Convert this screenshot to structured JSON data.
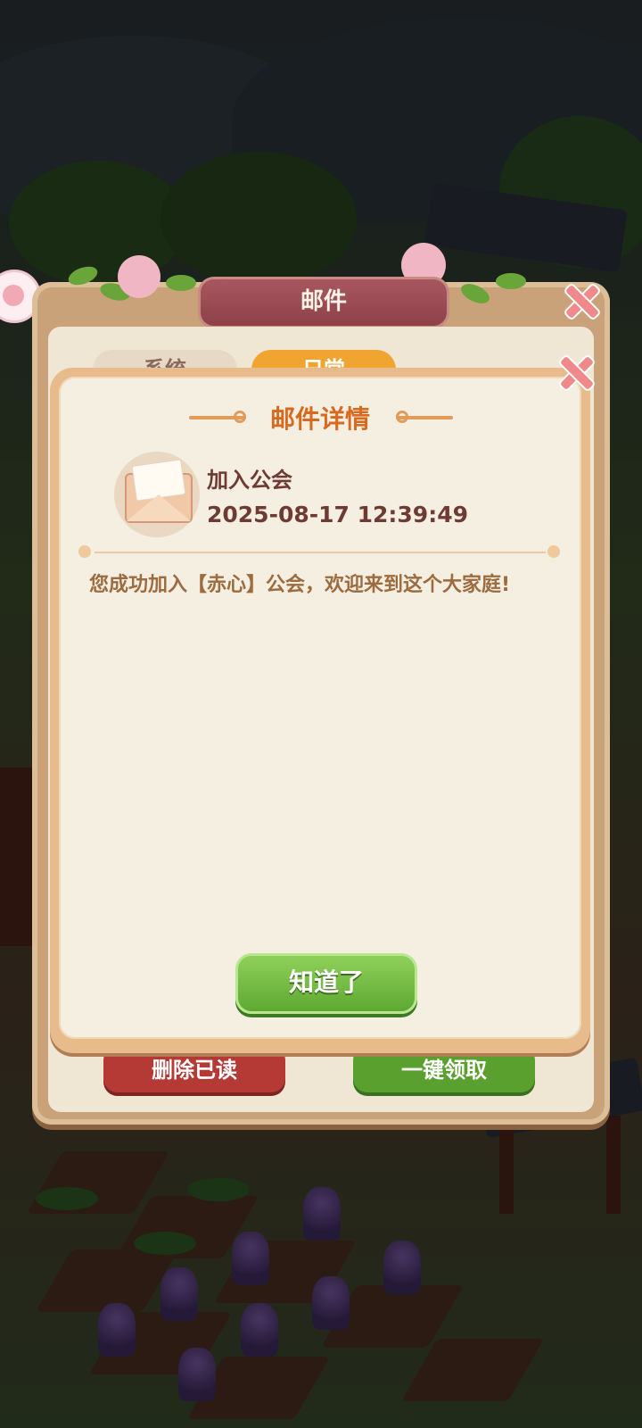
{
  "mail_panel": {
    "title": "邮件",
    "tabs": [
      {
        "label": "系统"
      },
      {
        "label": "日常"
      }
    ],
    "delete_read_label": "删除已读",
    "claim_all_label": "一键领取"
  },
  "dialog": {
    "title": "邮件详情",
    "subject": "加入公会",
    "time": "2025-08-17 12:39:49",
    "body": "您成功加入【赤心】公会，欢迎来到这个大家庭!",
    "ok_label": "知道了"
  },
  "colors": {
    "dialog_title": "#d86a20",
    "subject_text": "#6e3a34",
    "body_text": "#9c6b3e",
    "ok_button": "#5ea832"
  }
}
